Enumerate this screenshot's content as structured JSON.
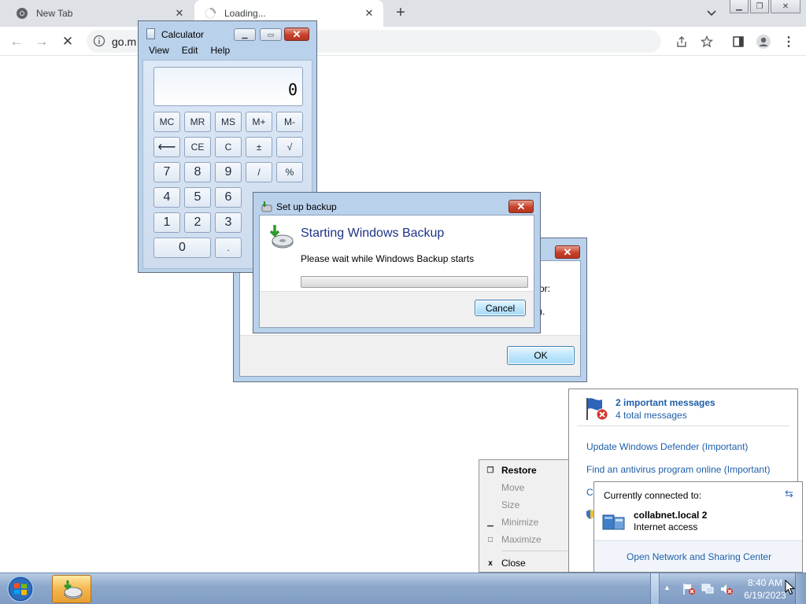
{
  "browser": {
    "tabs": [
      {
        "title": "New Tab",
        "icon": "chrome-icon",
        "active": false
      },
      {
        "title": "Loading...",
        "icon": "loading-spinner-icon",
        "active": true
      }
    ],
    "new_tab_label": "+",
    "address": "go.m"
  },
  "calculator": {
    "title": "Calculator",
    "menu": [
      "View",
      "Edit",
      "Help"
    ],
    "display": "0",
    "buttons": {
      "mc": "MC",
      "mr": "MR",
      "ms": "MS",
      "mplus": "M+",
      "mminus": "M-",
      "back": "⟵",
      "ce": "CE",
      "c": "C",
      "plusminus": "±",
      "sqrt": "√",
      "n7": "7",
      "n8": "8",
      "n9": "9",
      "div": "/",
      "pct": "%",
      "n4": "4",
      "n5": "5",
      "n6": "6",
      "n1": "1",
      "n2": "2",
      "n3": "3",
      "n0": "0",
      "dot": "."
    }
  },
  "background_dialog": {
    "ok_label": "OK",
    "partial_text_1": "or:",
    "partial_text_2": ")."
  },
  "backup_dialog": {
    "title": "Set up backup",
    "heading": "Starting Windows Backup",
    "message": "Please wait while Windows Backup starts",
    "cancel_label": "Cancel",
    "progress": 0
  },
  "context_menu": {
    "items": [
      {
        "label": "Restore",
        "enabled": true,
        "bold": true,
        "icon": "restore-icon"
      },
      {
        "label": "Move",
        "enabled": false,
        "bold": false,
        "icon": ""
      },
      {
        "label": "Size",
        "enabled": false,
        "bold": false,
        "icon": ""
      },
      {
        "label": "Minimize",
        "enabled": false,
        "bold": false,
        "icon": "minimize-icon"
      },
      {
        "label": "Maximize",
        "enabled": false,
        "bold": false,
        "icon": "maximize-icon"
      },
      {
        "label": "Close",
        "enabled": true,
        "bold": false,
        "icon": "close-icon"
      }
    ]
  },
  "action_center": {
    "important": "2 important messages",
    "total": "4 total messages",
    "links": [
      "Update Windows Defender (Important)",
      "Find an antivirus program online (Important)"
    ],
    "partial_link": "C"
  },
  "network": {
    "connected_label": "Currently connected to:",
    "network_name": "collabnet.local  2",
    "access": "Internet access",
    "footer_link": "Open Network and Sharing Center"
  },
  "taskbar": {
    "time": "8:40 AM",
    "date": "6/19/2023"
  },
  "colors": {
    "accent": "#1e5fa8",
    "heading_blue": "#1e3287",
    "close_red": "#c7412b",
    "taskbar": "#8ea9cc"
  }
}
